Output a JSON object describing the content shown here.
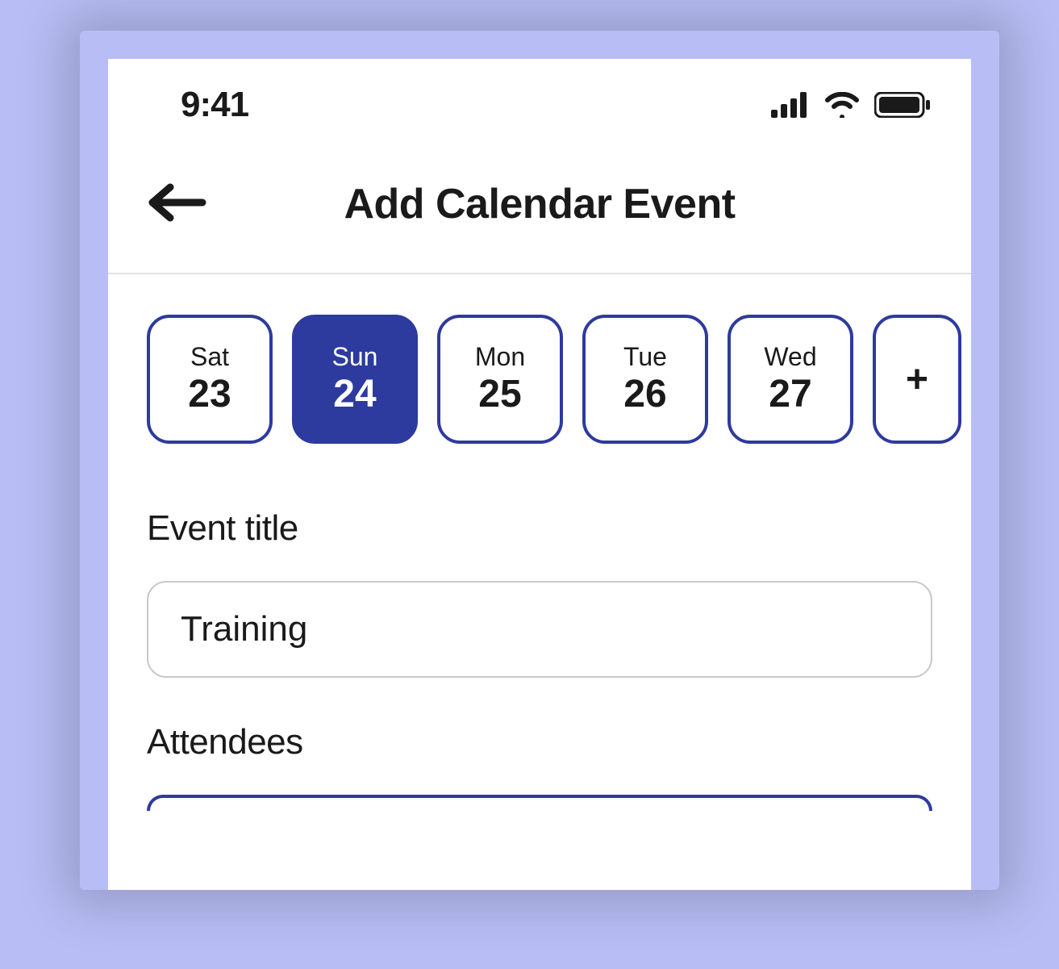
{
  "status": {
    "time": "9:41"
  },
  "header": {
    "title": "Add Calendar Event"
  },
  "dates": [
    {
      "day": "Sat",
      "num": "23",
      "selected": false
    },
    {
      "day": "Sun",
      "num": "24",
      "selected": true
    },
    {
      "day": "Mon",
      "num": "25",
      "selected": false
    },
    {
      "day": "Tue",
      "num": "26",
      "selected": false
    },
    {
      "day": "Wed",
      "num": "27",
      "selected": false
    }
  ],
  "add_date_icon": "+",
  "form": {
    "event_title_label": "Event title",
    "event_title_value": "Training",
    "attendees_label": "Attendees"
  }
}
